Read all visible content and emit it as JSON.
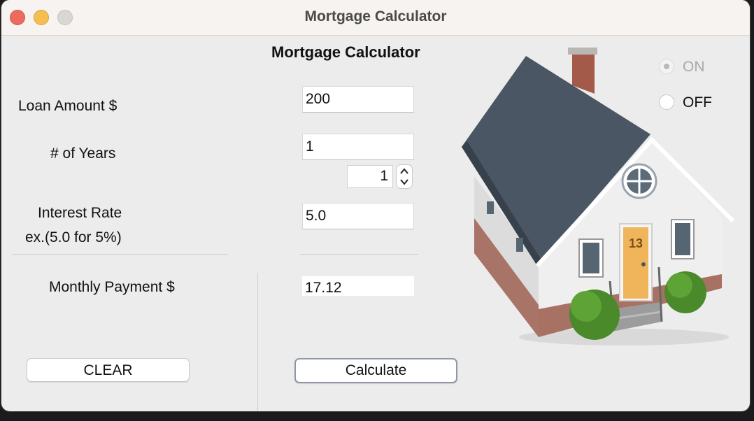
{
  "window": {
    "title": "Mortgage Calculator"
  },
  "form": {
    "heading": "Mortgage Calculator",
    "loan_amount_label": "Loan Amount $",
    "loan_amount_value": "200",
    "years_label": "# of Years",
    "years_value": "1",
    "years_spinner_value": "1",
    "interest_label": "Interest Rate",
    "interest_hint": "ex.(5.0 for 5%)",
    "interest_value": "5.0",
    "payment_label": "Monthly Payment $",
    "payment_value": "17.12"
  },
  "buttons": {
    "clear": "CLEAR",
    "calculate": "Calculate"
  },
  "radio": {
    "on_label": "ON",
    "off_label": "OFF",
    "on_selected": true,
    "on_disabled": true
  },
  "house": {
    "door_number": "13"
  },
  "colors": {
    "close": "#ed6a5e",
    "minimize": "#f5bf4f",
    "maximize": "#d9d7d5",
    "roof": "#4a5663",
    "wall": "#eeeeee",
    "brick": "#9a5a4a",
    "door": "#f0b45a",
    "bush": "#4a8a2a"
  }
}
